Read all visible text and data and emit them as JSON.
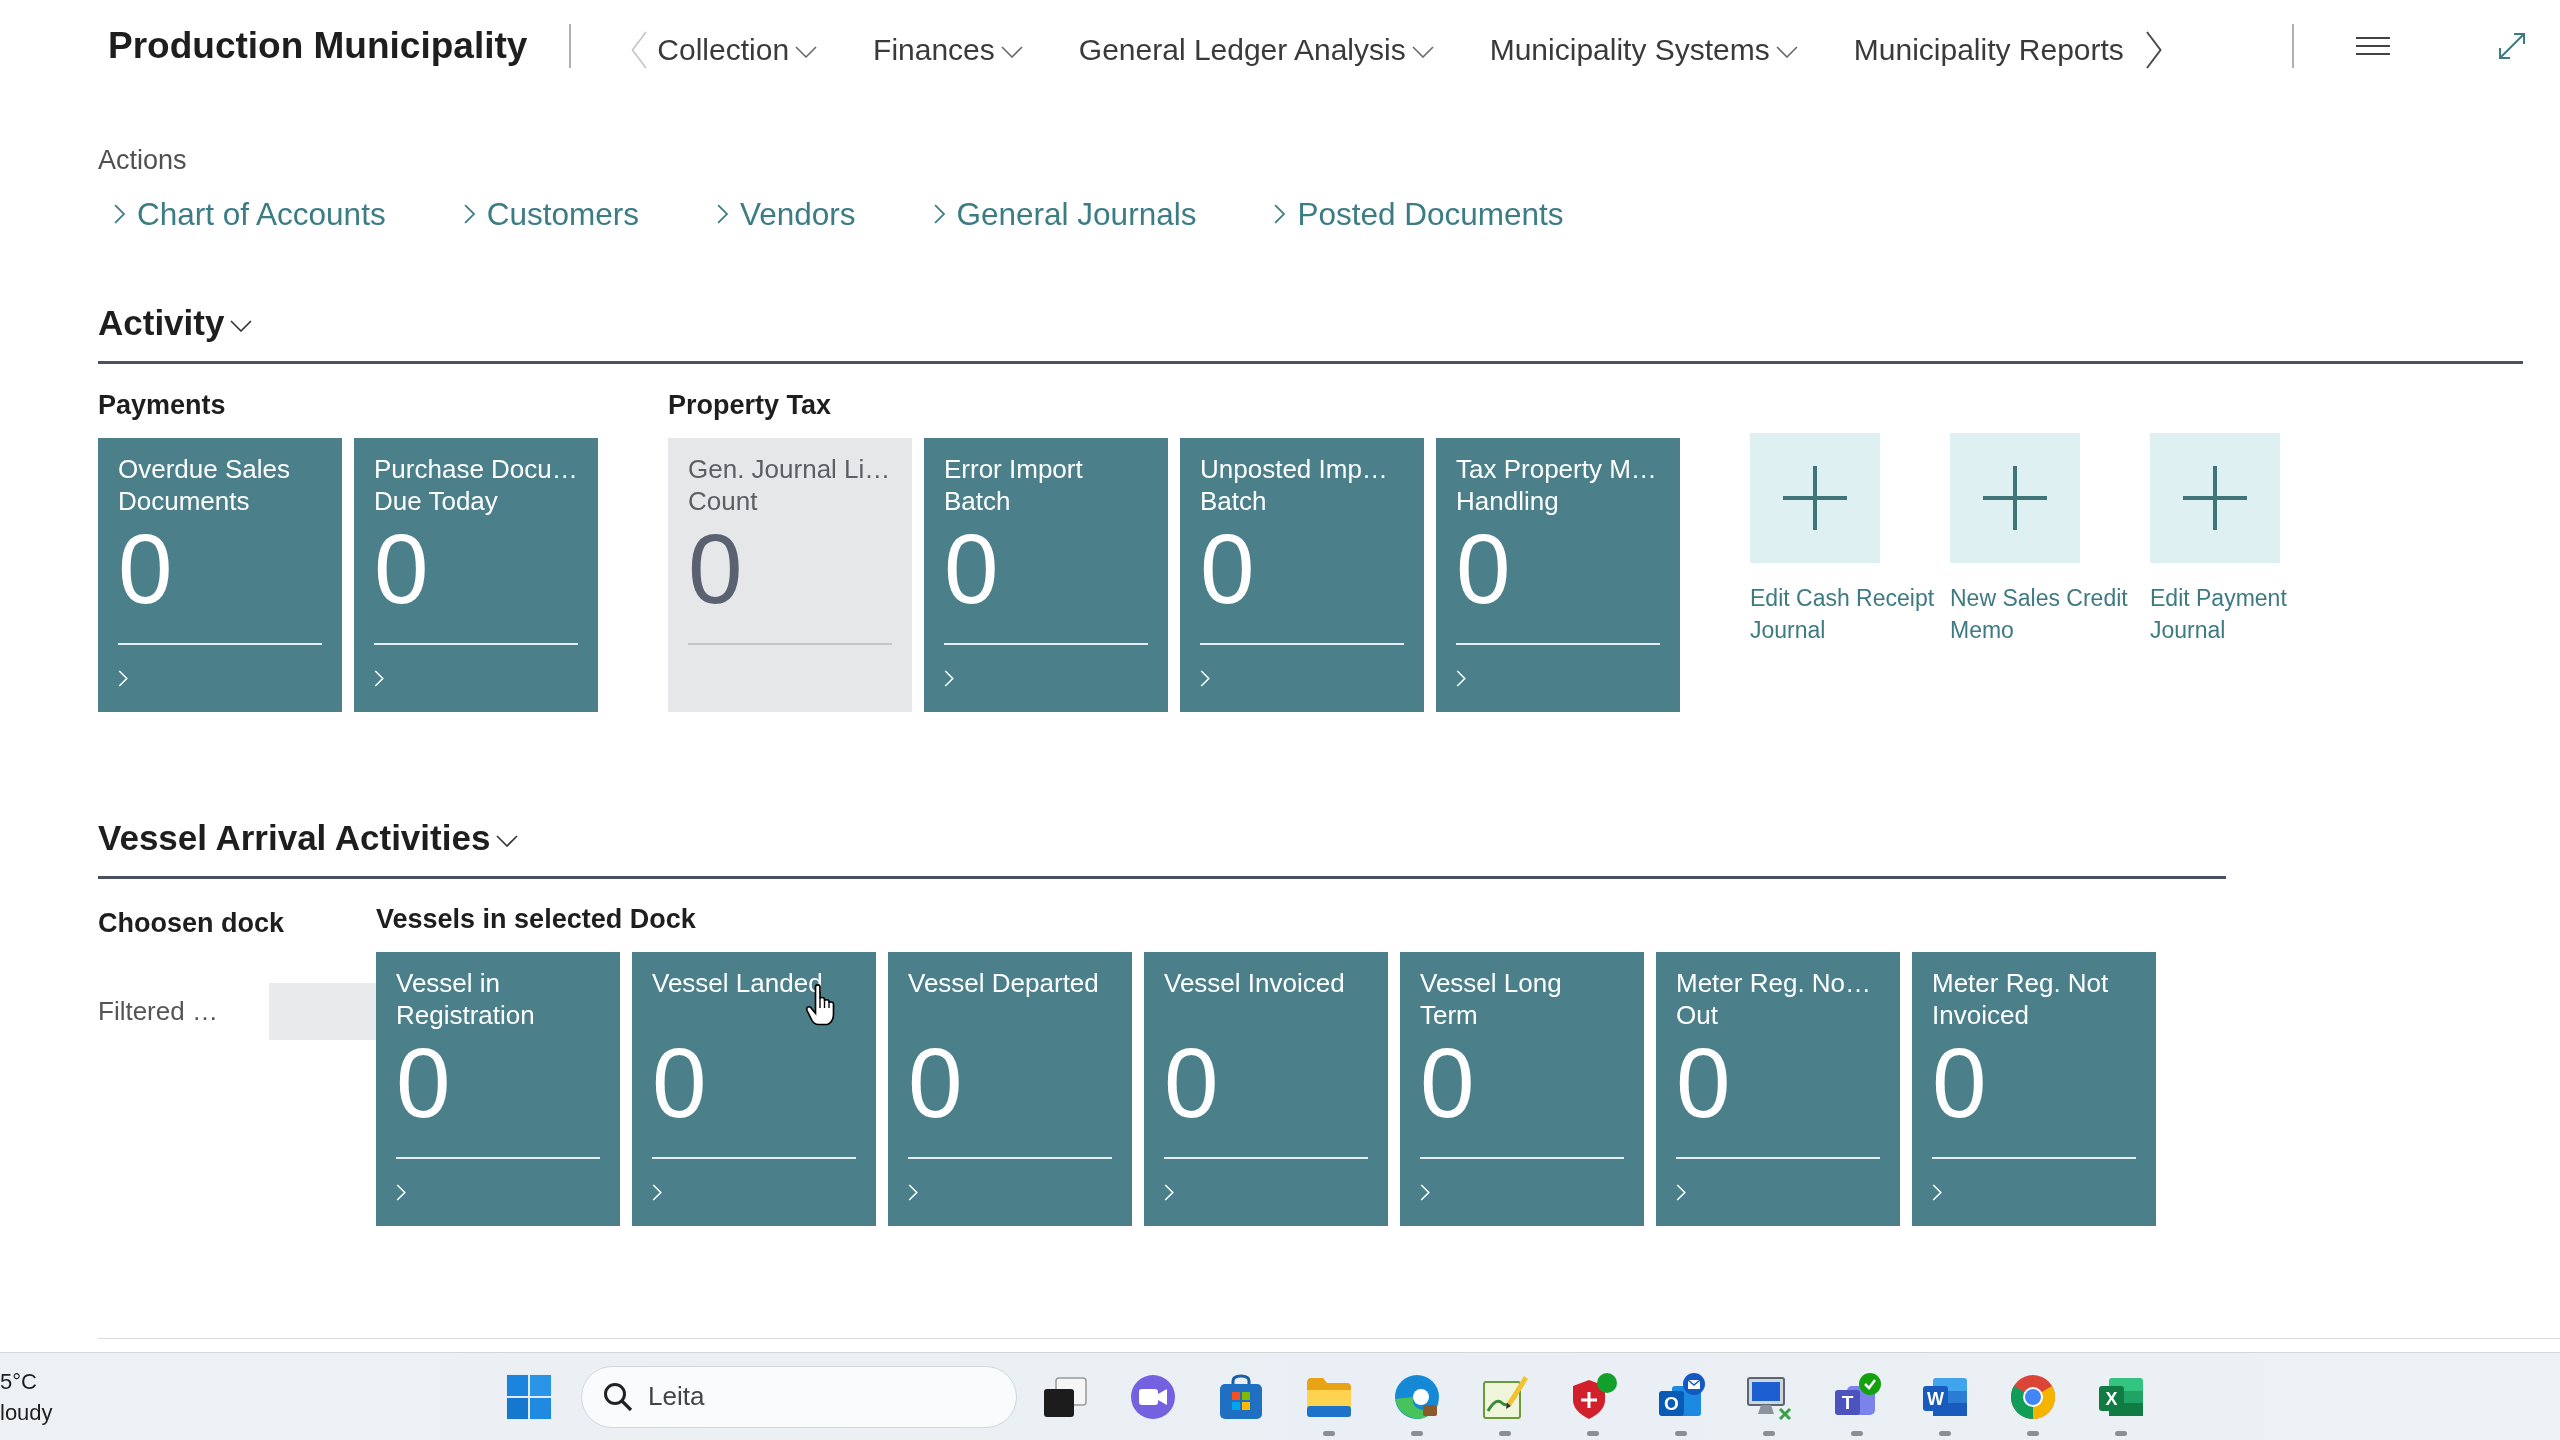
{
  "header": {
    "title": "Production Municipality",
    "nav": {
      "can_scroll_back": false,
      "can_scroll_forward": true,
      "items": [
        {
          "label": "Collection",
          "dropdown": true
        },
        {
          "label": "Finances",
          "dropdown": true
        },
        {
          "label": "General Ledger Analysis",
          "dropdown": true
        },
        {
          "label": "Municipality Systems",
          "dropdown": true
        },
        {
          "label": "Municipality Reports",
          "dropdown": false
        }
      ]
    }
  },
  "actions": {
    "label": "Actions",
    "links": [
      "Chart of Accounts",
      "Customers",
      "Vendors",
      "General Journals",
      "Posted Documents"
    ]
  },
  "activity": {
    "title": "Activity",
    "expanded": true,
    "groups": [
      {
        "title": "Payments",
        "tiles": [
          {
            "kind": "standard",
            "title": "Overdue Sales\nDocuments",
            "value": "0"
          },
          {
            "kind": "standard",
            "title": "Purchase Docu…\nDue Today",
            "value": "0"
          }
        ]
      },
      {
        "title": "Property Tax",
        "tiles": [
          {
            "kind": "neutral",
            "title": "Gen. Journal Li…\nCount",
            "value": "0"
          },
          {
            "kind": "standard",
            "title": "Error Import\nBatch",
            "value": "0"
          },
          {
            "kind": "standard",
            "title": "Unposted Imp…\nBatch",
            "value": "0"
          },
          {
            "kind": "standard",
            "title": "Tax Property M…\nHandling",
            "value": "0"
          }
        ]
      }
    ],
    "actions": [
      "Edit Cash Receipt Journal",
      "New Sales Credit Memo",
      "Edit Payment Journal"
    ]
  },
  "vessel": {
    "title": "Vessel Arrival Activities",
    "expanded": true,
    "dock": {
      "label": "Choosen dock",
      "field_label": "Filtered …"
    },
    "group": {
      "title": "Vessels in selected Dock",
      "tiles": [
        {
          "kind": "standard",
          "title": "Vessel in\nRegistration",
          "value": "0"
        },
        {
          "kind": "standard",
          "title": "Vessel Landed",
          "value": "0"
        },
        {
          "kind": "standard",
          "title": "Vessel Departed",
          "value": "0"
        },
        {
          "kind": "standard",
          "title": "Vessel Invoiced",
          "value": "0"
        },
        {
          "kind": "standard",
          "title": "Vessel Long\nTerm",
          "value": "0"
        },
        {
          "kind": "standard",
          "title": "Meter Reg. No…\nOut",
          "value": "0"
        },
        {
          "kind": "standard",
          "title": "Meter Reg. Not\nInvoiced",
          "value": "0"
        }
      ]
    }
  },
  "taskbar": {
    "weather": {
      "temperature": "5°C",
      "condition": "loudy"
    },
    "search": {
      "placeholder": "Leita"
    },
    "apps": [
      {
        "kind": "task-view",
        "running": false
      },
      {
        "kind": "video-chat",
        "running": false
      },
      {
        "kind": "store",
        "running": false
      },
      {
        "kind": "folder",
        "running": true
      },
      {
        "kind": "browser-swirl",
        "running": true
      },
      {
        "kind": "drawing",
        "running": true
      },
      {
        "kind": "shield",
        "running": true
      },
      {
        "kind": "mail",
        "letter": "O",
        "running": true
      },
      {
        "kind": "computer",
        "running": true
      },
      {
        "kind": "team-chat",
        "letter": "T",
        "running": true
      },
      {
        "kind": "document",
        "letter": "W",
        "running": true
      },
      {
        "kind": "browser",
        "running": true
      },
      {
        "kind": "spreadsheet",
        "letter": "X",
        "running": true
      }
    ]
  }
}
